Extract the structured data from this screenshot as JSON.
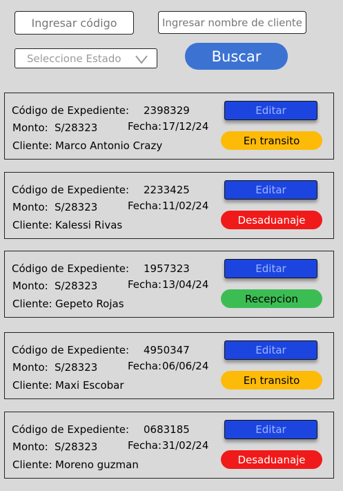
{
  "search": {
    "code_placeholder": "Ingresar código",
    "client_placeholder": "Ingresar nombre de cliente",
    "status_placeholder": "Seleccione Estado",
    "button_label": "Buscar"
  },
  "labels": {
    "code": "Código de Expediente:",
    "amount": "Monto:",
    "date": "Fecha:",
    "client": "Cliente:",
    "edit": "Editar"
  },
  "status_colors": {
    "En transito": "#fdbb08",
    "Desaduanaje": "#f01a1a",
    "Recepcion": "#3cbd54"
  },
  "records": [
    {
      "code": "2398329",
      "amount": "S/28323",
      "date": "17/12/24",
      "client": "Marco Antonio Crazy",
      "status": "En transito"
    },
    {
      "code": "2233425",
      "amount": "S/28323",
      "date": "11/02/24",
      "client": "Kalessi Rivas",
      "status": "Desaduanaje"
    },
    {
      "code": "1957323",
      "amount": "S/28323",
      "date": "13/04/24",
      "client": "Gepeto Rojas",
      "status": "Recepcion"
    },
    {
      "code": "4950347",
      "amount": "S/28323",
      "date": "06/06/24",
      "client": "Maxi Escobar",
      "status": "En transito"
    },
    {
      "code": "0683185",
      "amount": "S/28323",
      "date": "31/02/24",
      "client": "Moreno guzman",
      "status": "Desaduanaje"
    }
  ]
}
